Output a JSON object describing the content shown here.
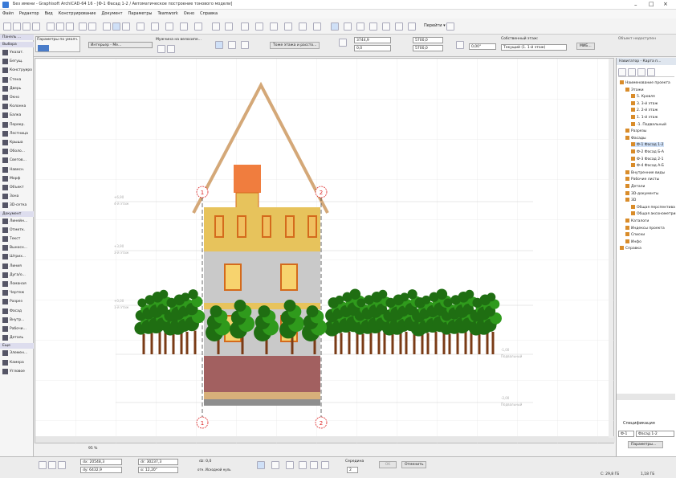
{
  "window": {
    "title": "Без имени - Graphisoft ArchiCAD-64 16 - [Ф-1 Фасад 1-2 / Автоматическое построение тонового модели]"
  },
  "menu": [
    "Файл",
    "Редактор",
    "Вид",
    "Конструирование",
    "Документ",
    "Параметры",
    "Teamwork",
    "Окно",
    "Справка"
  ],
  "infobox": {
    "param_label": "Параметры по умолч.",
    "layer_label": "Интерьер - Ме...",
    "story_label": "Мужчина на велосипе...",
    "all_stories_button": "Тоже этажа и рассто...",
    "val_a": "3744,9",
    "val_b": "0,0",
    "val_c": "5700,0",
    "val_d": "5700,0",
    "val_e": "0,00°",
    "own_story_label": "Собственный этаж:",
    "own_story_value": "Текущий (1. 1-й этаж)",
    "model_button": "МИБ..."
  },
  "object_label": "Объект недоступен",
  "toolbox": {
    "header": "Панель ...",
    "select_label": "Выбора",
    "items_top": [
      "Указат.",
      "Бегущ.",
      "Конструиров",
      "Стена",
      "Дверь",
      "Окно",
      "Колонна",
      "Балка",
      "Перекр.",
      "Лестница",
      "Крыша",
      "Оболо...",
      "Светов...",
      "Навесн.",
      "Морф",
      "Объект",
      "Зона",
      "3D-сетка"
    ],
    "doc_section": "Документ",
    "items_doc": [
      "Линейн...",
      "Отметк.",
      "Текст",
      "Выносн...",
      "Штрих...",
      "Линия",
      "Дуга/о...",
      "Ломаная",
      "Чертеж",
      "Разрез",
      "Фасад",
      "Внутр...",
      "Рабочи...",
      "Деталь"
    ],
    "more_section": "Еще",
    "items_more": [
      "Элемен...",
      "Камера",
      "Угловое"
    ]
  },
  "navigator": {
    "header": "Навигатор - Карта п...",
    "items": [
      {
        "label": "Наименование проекта",
        "indent": 0
      },
      {
        "label": "Этажи",
        "indent": 1
      },
      {
        "label": "5. Кровля",
        "indent": 2
      },
      {
        "label": "3. 3-й этаж",
        "indent": 2
      },
      {
        "label": "2. 2-й этаж",
        "indent": 2
      },
      {
        "label": "1. 1-й этаж",
        "indent": 2
      },
      {
        "label": "-1. Подвальный",
        "indent": 2
      },
      {
        "label": "Разрезы",
        "indent": 1
      },
      {
        "label": "Фасады",
        "indent": 1
      },
      {
        "label": "Ф-1 Фасад 1-2",
        "indent": 2
      },
      {
        "label": "Ф-2 Фасад Б-А",
        "indent": 2
      },
      {
        "label": "Ф-3 Фасад 2-1",
        "indent": 2
      },
      {
        "label": "Ф-4 Фасад А-Б",
        "indent": 2
      },
      {
        "label": "Внутренние виды",
        "indent": 1
      },
      {
        "label": "Рабочие листы",
        "indent": 1
      },
      {
        "label": "Детали",
        "indent": 1
      },
      {
        "label": "3D-документы",
        "indent": 1
      },
      {
        "label": "3D",
        "indent": 1
      },
      {
        "label": "Общая перспектива",
        "indent": 2
      },
      {
        "label": "Общая аксонометрия",
        "indent": 2
      },
      {
        "label": "Каталоги",
        "indent": 1
      },
      {
        "label": "Индексы проекта",
        "indent": 1
      },
      {
        "label": "Списки",
        "indent": 1
      },
      {
        "label": "Инфо",
        "indent": 1
      },
      {
        "label": "Справка",
        "indent": 0
      }
    ],
    "spec_header": "Спецификация",
    "spec_id": "Ф-1",
    "spec_name": "Фасад 1-2",
    "params_button": "Параметры..."
  },
  "canvas": {
    "axis_labels": [
      "1",
      "2",
      "1",
      "2"
    ],
    "level_texts": [
      "+6,90",
      "4-й этаж",
      "+3,90",
      "3-й этаж",
      "+0,00",
      "1-й этаж",
      "-1,00",
      "Подвальный",
      "-2,00",
      "Подвальный"
    ]
  },
  "statusbar": {
    "zoom": "95 %",
    "dx": "dx: 20548,3",
    "dy": "dy: 6432,9",
    "dr": "dr: 30237,3",
    "da": "α: 12,20°",
    "dz": "dz: 0,0",
    "ref": "отн. Исходной нуль",
    "snap": "Середина",
    "snap_n": "2",
    "ok": "OK",
    "cancel": "Отменить",
    "disk1": "С: 29,8 ГБ",
    "disk2": "1,18 ГБ"
  },
  "colors": {
    "tree_green": "#2f9a1c",
    "tree_dark": "#1f6e12",
    "facade_top": "#e7c35c",
    "facade_mid": "#c9c9c9",
    "plinth": "#a26060",
    "roof": "#d4a878",
    "chimney": "#f07d3e",
    "window_frame": "#d46a1c"
  }
}
